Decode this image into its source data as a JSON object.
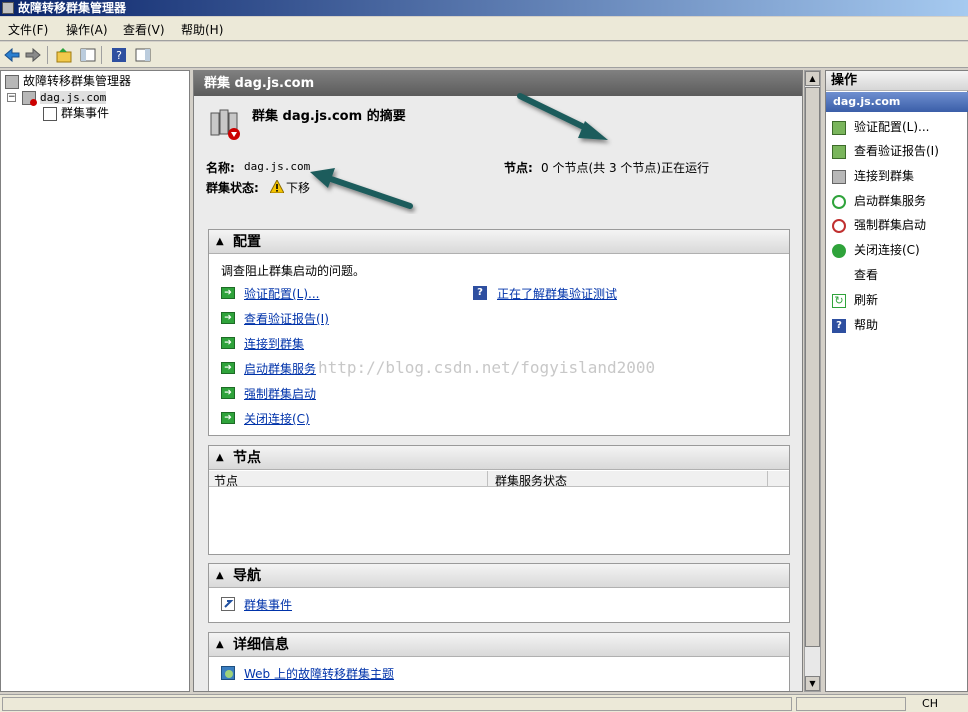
{
  "window": {
    "title": "故障转移群集管理器"
  },
  "menu": {
    "file": "文件(F)",
    "action": "操作(A)",
    "view": "查看(V)",
    "help": "帮助(H)"
  },
  "tree": {
    "root": "故障转移群集管理器",
    "cluster": "dag.js.com",
    "events": "群集事件",
    "expander": "−"
  },
  "center": {
    "header": "群集 dag.js.com",
    "summary_title": "群集 dag.js.com 的摘要",
    "name_label": "名称:",
    "name_value": "dag.js.com",
    "status_label": "群集状态:",
    "status_value": "下移",
    "nodes_label": "节点:",
    "nodes_value": "0 个节点(共 3 个节点)正在运行",
    "config_section": {
      "title": "配置",
      "description": "调查阻止群集启动的问题。",
      "links": [
        "验证配置(L)...",
        "查看验证报告(I)",
        "连接到群集",
        "启动群集服务",
        "强制群集启动",
        "关闭连接(C)"
      ],
      "help_link": "正在了解群集验证测试"
    },
    "nodes_section": {
      "title": "节点",
      "columns": [
        "节点",
        "群集服务状态"
      ]
    },
    "nav_section": {
      "title": "导航",
      "links": [
        "群集事件"
      ]
    },
    "details_section": {
      "title": "详细信息",
      "links": [
        "Web 上的故障转移群集主题"
      ]
    },
    "watermark": "http://blog.csdn.net/fogyisland2000"
  },
  "actions": {
    "header": "操作",
    "subheader": "dag.js.com",
    "items": [
      "验证配置(L)...",
      "查看验证报告(I)",
      "连接到群集",
      "启动群集服务",
      "强制群集启动",
      "关闭连接(C)",
      "查看",
      "刷新",
      "帮助"
    ]
  },
  "statusbar": {
    "lang": "CH"
  },
  "colors": {
    "accent_blue": "#0a246a",
    "link": "#0033aa",
    "arrow": "#1f5c5c",
    "green": "#2fa33b"
  }
}
